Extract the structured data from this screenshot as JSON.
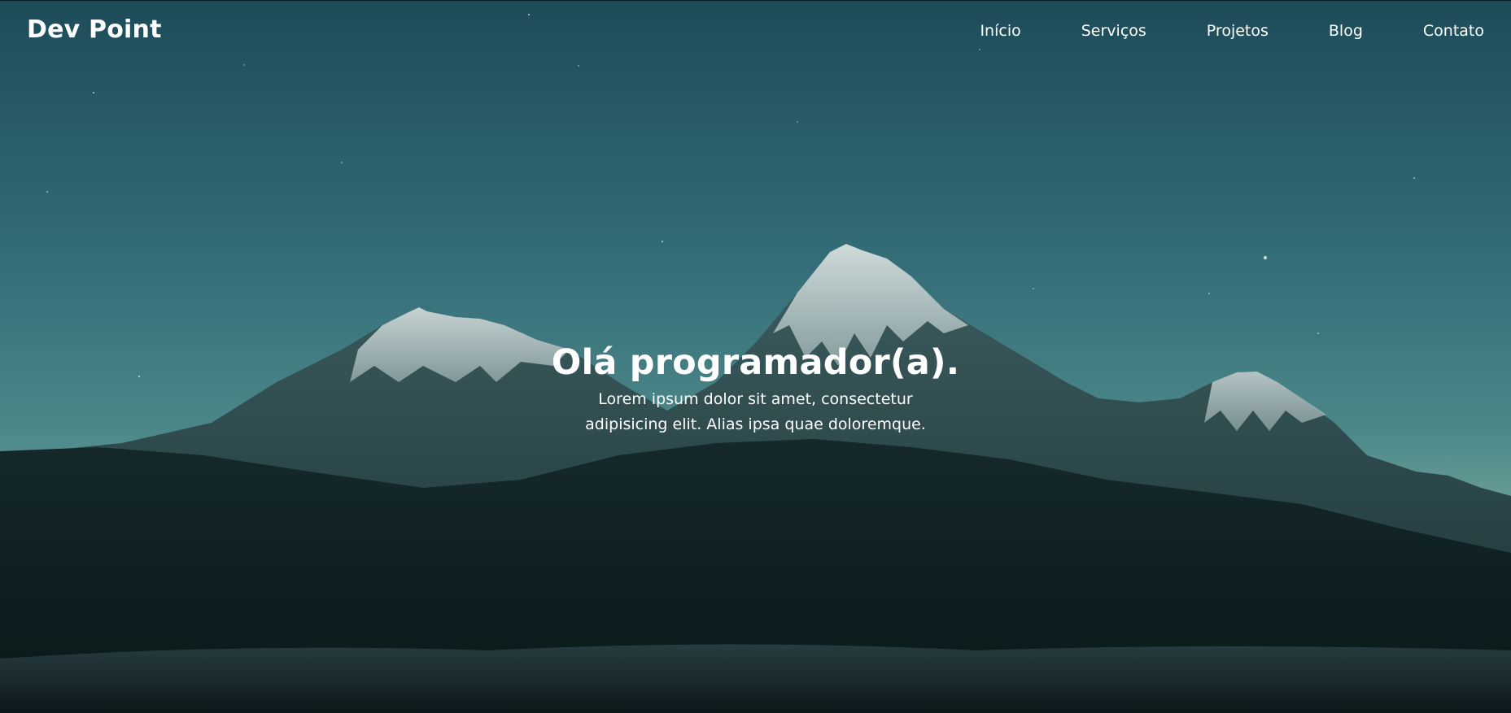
{
  "brand": {
    "name": "Dev Point"
  },
  "nav": {
    "items": [
      {
        "label": "Início"
      },
      {
        "label": "Serviços"
      },
      {
        "label": "Projetos"
      },
      {
        "label": "Blog"
      },
      {
        "label": "Contato"
      }
    ]
  },
  "hero": {
    "title": "Olá programador(a).",
    "text": "Lorem ipsum dolor sit amet, consectetur adipisicing elit. Alias ipsa quae doloremque."
  },
  "colors": {
    "sky_top": "#1f4f5c",
    "sky_mid": "#4d8a8c",
    "mountain_dark": "#0e2124",
    "snow": "#c7d5d6",
    "text": "#ffffff"
  }
}
